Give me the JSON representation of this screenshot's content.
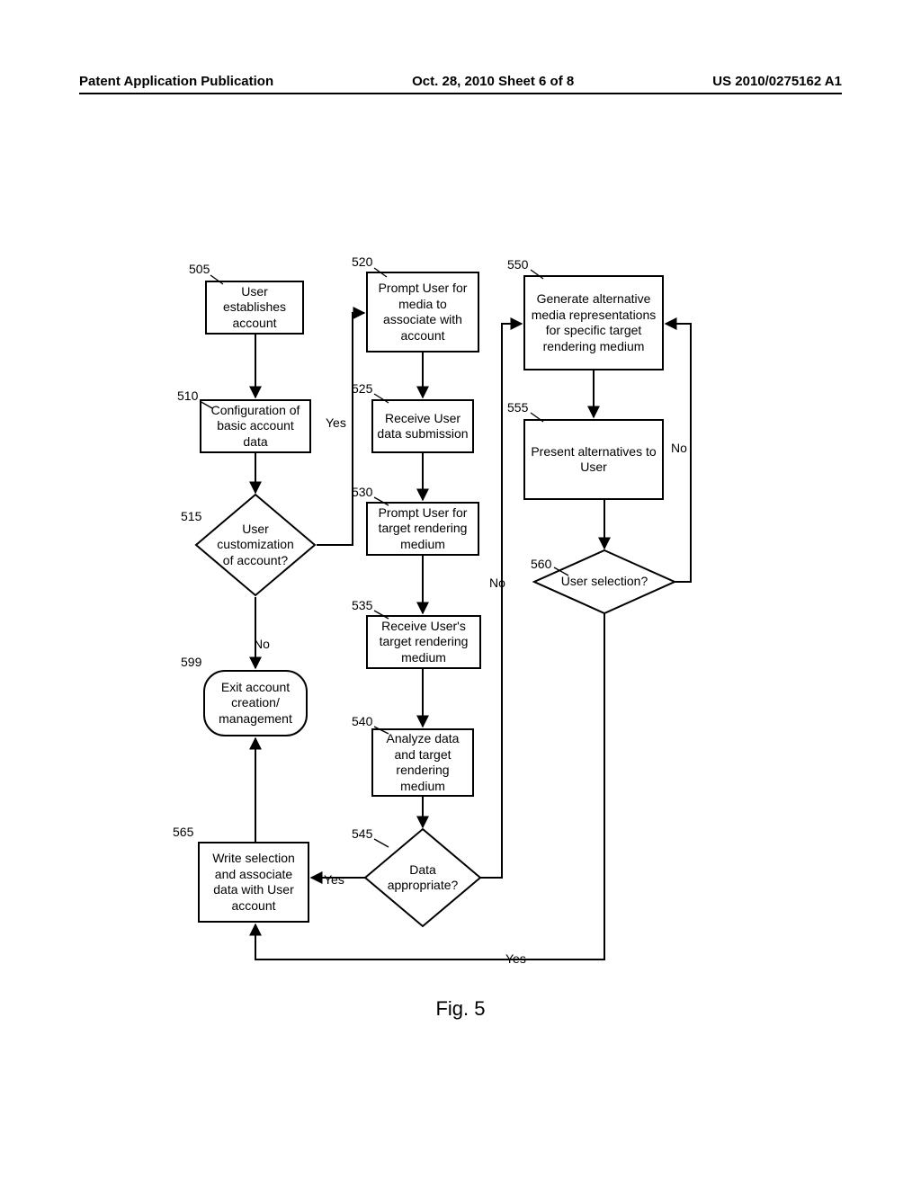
{
  "header": {
    "left": "Patent Application Publication",
    "center": "Oct. 28, 2010  Sheet 6 of 8",
    "right": "US 2010/0275162 A1"
  },
  "refs": {
    "r505": "505",
    "r510": "510",
    "r515": "515",
    "r520": "520",
    "r525": "525",
    "r530": "530",
    "r535": "535",
    "r540": "540",
    "r545": "545",
    "r550": "550",
    "r555": "555",
    "r560": "560",
    "r565": "565",
    "r599": "599"
  },
  "boxes": {
    "b505": "User establishes account",
    "b510": "Configuration of basic account data",
    "b515": "User customization of account?",
    "b520": "Prompt User for media to associate with account",
    "b525": "Receive User data submission",
    "b530": "Prompt User for target rendering medium",
    "b535": "Receive User's target rendering medium",
    "b540": "Analyze data and target rendering medium",
    "b545": "Data appropriate?",
    "b550": "Generate alternative media representations for specific target rendering medium",
    "b555": "Present alternatives to User",
    "b560": "User selection?",
    "b565": "Write selection and associate data with User account",
    "b599": "Exit account creation/ management"
  },
  "edges": {
    "yes": "Yes",
    "no": "No",
    "yes2": "Yes",
    "no2": "No",
    "yes3": "Yes",
    "no3": "No"
  },
  "figure": "Fig. 5"
}
